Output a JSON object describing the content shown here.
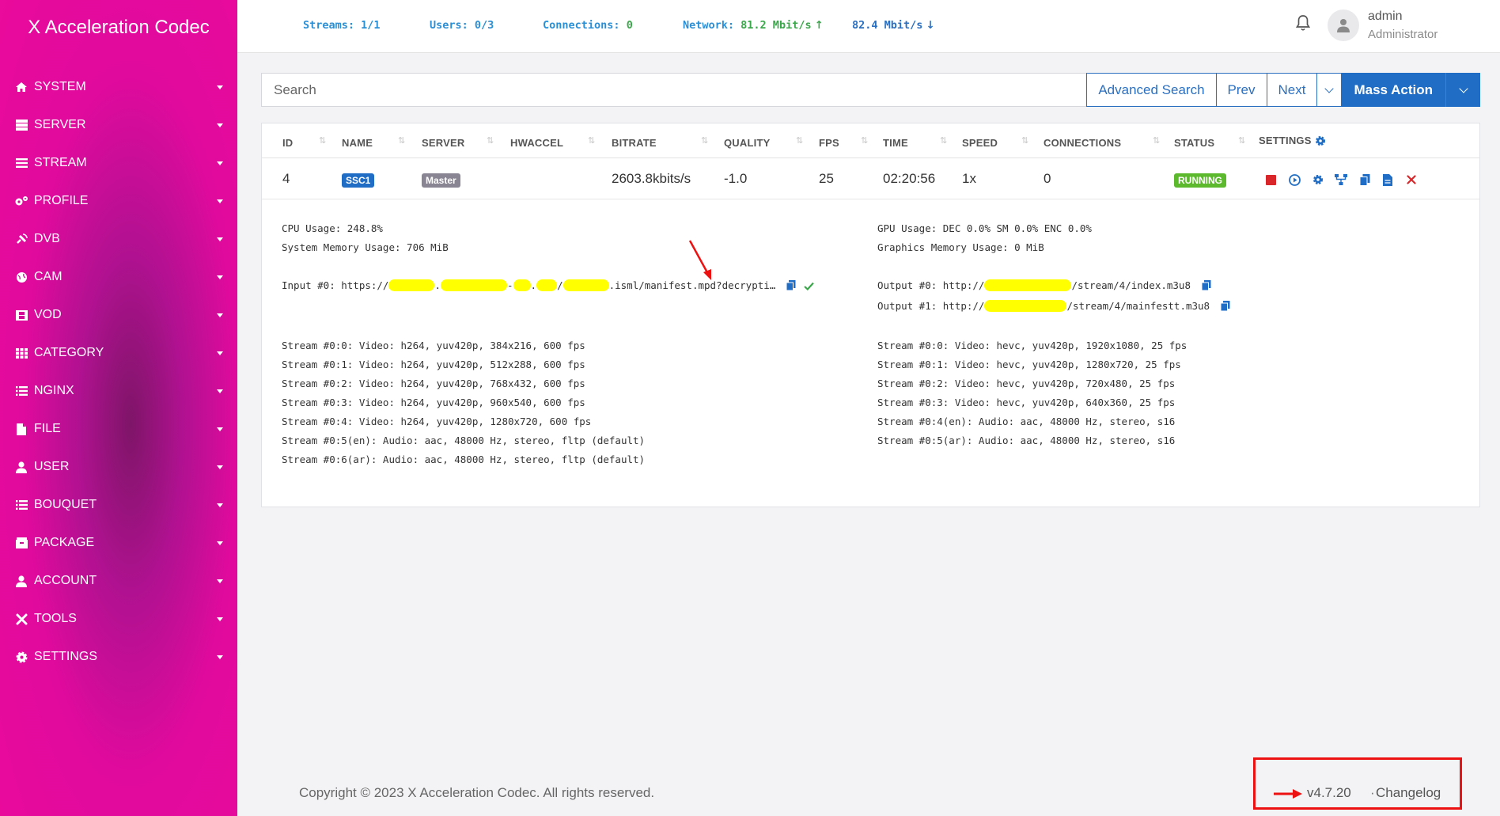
{
  "app": {
    "title": "X Acceleration Codec"
  },
  "sidebar": {
    "items": [
      {
        "label": "SYSTEM",
        "icon": "home-icon"
      },
      {
        "label": "SERVER",
        "icon": "server-icon"
      },
      {
        "label": "STREAM",
        "icon": "list-icon"
      },
      {
        "label": "PROFILE",
        "icon": "cogs-icon"
      },
      {
        "label": "DVB",
        "icon": "satellite-icon"
      },
      {
        "label": "CAM",
        "icon": "globe-icon"
      },
      {
        "label": "VOD",
        "icon": "film-icon"
      },
      {
        "label": "CATEGORY",
        "icon": "grid-icon"
      },
      {
        "label": "NGINX",
        "icon": "list-ul-icon"
      },
      {
        "label": "FILE",
        "icon": "file-icon"
      },
      {
        "label": "USER",
        "icon": "user-icon"
      },
      {
        "label": "BOUQUET",
        "icon": "list-ul-icon"
      },
      {
        "label": "PACKAGE",
        "icon": "package-icon"
      },
      {
        "label": "ACCOUNT",
        "icon": "user-icon"
      },
      {
        "label": "TOOLS",
        "icon": "tools-icon"
      },
      {
        "label": "SETTINGS",
        "icon": "gear-icon"
      }
    ]
  },
  "topbar": {
    "streams_label": "Streams:",
    "streams_value": "1/1",
    "users_label": "Users:",
    "users_value": "0/3",
    "connections_label": "Connections:",
    "connections_value": "0",
    "network_label": "Network:",
    "network_up": "81.2 Mbit/s",
    "network_down": "82.4 Mbit/s",
    "user_name": "admin",
    "user_role": "Administrator"
  },
  "search": {
    "placeholder": "Search",
    "advanced_label": "Advanced Search",
    "prev_label": "Prev",
    "next_label": "Next",
    "mass_action_label": "Mass Action"
  },
  "table": {
    "headers": {
      "id": "ID",
      "name": "NAME",
      "server": "SERVER",
      "hwaccel": "HWACCEL",
      "bitrate": "BITRATE",
      "quality": "QUALITY",
      "fps": "FPS",
      "time": "TIME",
      "speed": "SPEED",
      "connections": "CONNECTIONS",
      "status": "STATUS",
      "settings": "SETTINGS"
    },
    "row": {
      "id": "4",
      "name": "SSC1",
      "server": "Master",
      "hwaccel": "",
      "bitrate": "2603.8kbits/s",
      "quality": "-1.0",
      "fps": "25",
      "time": "02:20:56",
      "speed": "1x",
      "connections": "0",
      "status": "RUNNING"
    }
  },
  "details": {
    "cpu": "CPU Usage: 248.8%",
    "memory": "System Memory Usage: 706 MiB",
    "gpu": "GPU Usage: DEC 0.0% SM 0.0% ENC 0.0%",
    "gmem": "Graphics Memory Usage: 0 MiB",
    "input_prefix": "Input #0: https://",
    "input_suffix": ".isml/manifest.mpd?decrypti…",
    "output0_prefix": "Output #0: http://",
    "output0_suffix": "/stream/4/index.m3u8",
    "output1_prefix": "Output #1: http://",
    "output1_suffix": "/stream/4/mainfestt.m3u8",
    "input_streams": [
      "Stream #0:0: Video: h264, yuv420p, 384x216, 600 fps",
      "Stream #0:1: Video: h264, yuv420p, 512x288, 600 fps",
      "Stream #0:2: Video: h264, yuv420p, 768x432, 600 fps",
      "Stream #0:3: Video: h264, yuv420p, 960x540, 600 fps",
      "Stream #0:4: Video: h264, yuv420p, 1280x720, 600 fps",
      "Stream #0:5(en): Audio: aac, 48000 Hz, stereo, fltp (default)",
      "Stream #0:6(ar): Audio: aac, 48000 Hz, stereo, fltp (default)"
    ],
    "output_streams": [
      "Stream #0:0: Video: hevc, yuv420p, 1920x1080, 25 fps",
      "Stream #0:1: Video: hevc, yuv420p, 1280x720, 25 fps",
      "Stream #0:2: Video: hevc, yuv420p, 720x480, 25 fps",
      "Stream #0:3: Video: hevc, yuv420p, 640x360, 25 fps",
      "Stream #0:4(en): Audio: aac, 48000 Hz, stereo, s16",
      "Stream #0:5(ar): Audio: aac, 48000 Hz, stereo, s16"
    ]
  },
  "footer": {
    "copyright": "Copyright © 2023 X Acceleration Codec. All rights reserved.",
    "version": "v4.7.20",
    "separator": "·",
    "changelog": "Changelog"
  },
  "colors": {
    "sidebar": "#e20a9c",
    "primary": "#1f6dc4",
    "running": "#5cb82d",
    "name_badge": "#1f6dc4",
    "server_badge": "#8a8592",
    "annotation": "#ee1111",
    "redaction": "#ffff00"
  }
}
